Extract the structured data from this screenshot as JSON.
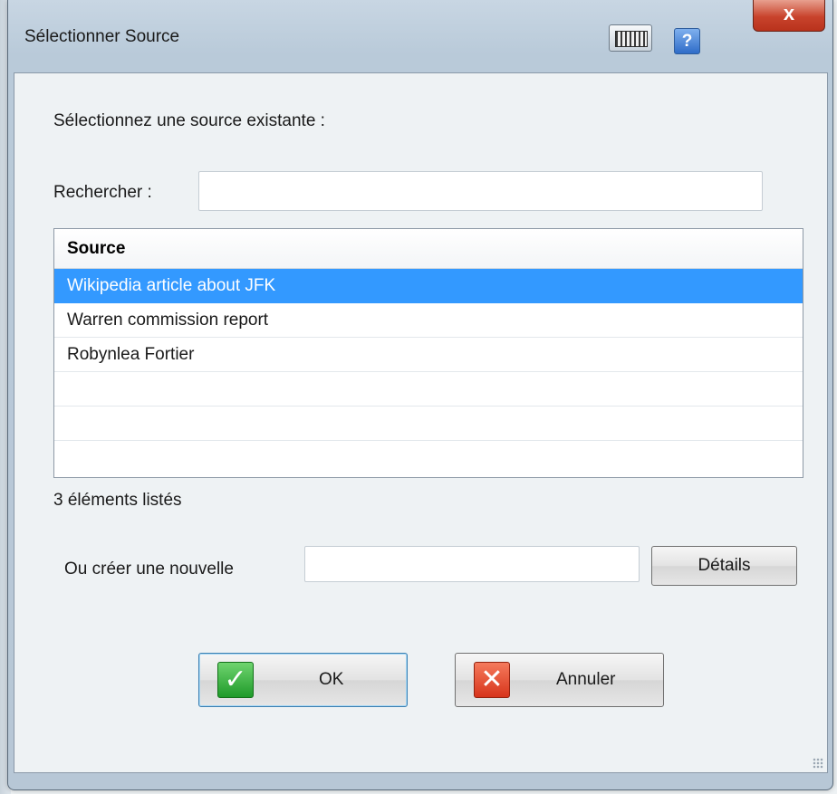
{
  "window": {
    "title": "Sélectionner Source",
    "help_label": "?",
    "close_label": "x"
  },
  "form": {
    "prompt": "Sélectionnez une source existante :",
    "search_label": "Rechercher :",
    "search_value": "",
    "list_header": "Source",
    "rows": [
      "Wikipedia article about JFK",
      "Warren commission report",
      "Robynlea Fortier",
      "",
      "",
      ""
    ],
    "selected_row": 0,
    "count_text": "3 éléments listés",
    "new_label": "Ou créer une nouvelle",
    "new_value": "",
    "details_label": "Détails"
  },
  "buttons": {
    "ok_label": "OK",
    "cancel_label": "Annuler"
  },
  "icons": {
    "ok": "check-icon",
    "cancel": "x-icon",
    "keyboard": "keyboard-icon",
    "help": "help-icon"
  },
  "colors": {
    "selection": "#3399ff",
    "close": "#c8432c",
    "ok_icon": "#1f9a2a",
    "cancel_icon": "#d7341b"
  }
}
